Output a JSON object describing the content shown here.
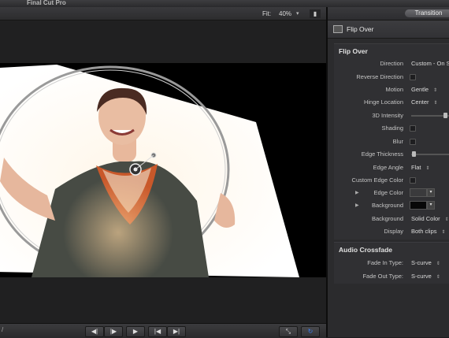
{
  "window": {
    "app_title": "Final Cut Pro"
  },
  "viewer": {
    "fit_label": "Fit:",
    "fit_value": "40%",
    "view_switch_glyph": "▮"
  },
  "transport": {
    "left_glyph": "/",
    "prev_glyph": "◀︎|",
    "next_glyph": "|▶︎",
    "play_glyph": "▶",
    "start_glyph": "|◀",
    "end_glyph": "▶|",
    "fullscreen_glyph": "⤡",
    "loop_glyph": "↻"
  },
  "inspector": {
    "tab_label": "Transition",
    "header_title": "Flip Over",
    "flip_over": {
      "title": "Flip Over",
      "direction_label": "Direction",
      "direction_value": "Custom - On Scr",
      "reverse_label": "Reverse Direction",
      "motion_label": "Motion",
      "motion_value": "Gentle",
      "hinge_label": "Hinge Location",
      "hinge_value": "Center",
      "intensity_label": "3D Intensity",
      "intensity_level": 0.75,
      "shading_label": "Shading",
      "blur_label": "Blur",
      "edge_thickness_label": "Edge Thickness",
      "edge_thickness_level": 0.02,
      "edge_angle_label": "Edge Angle",
      "edge_angle_value": "Flat",
      "custom_edge_color_label": "Custom Edge Color",
      "edge_color_label": "Edge Color",
      "edge_color_swatch": "#3a3a3c",
      "background_color_label": "Background",
      "background_color_swatch": "#080808",
      "background_type_label": "Background",
      "background_type_value": "Solid Color",
      "display_label": "Display",
      "display_value": "Both clips"
    },
    "audio_crossfade": {
      "title": "Audio Crossfade",
      "fade_in_label": "Fade In Type:",
      "fade_in_value": "S-curve",
      "fade_out_label": "Fade Out Type:",
      "fade_out_value": "S-curve"
    }
  },
  "colors": {
    "accent_blue": "#3a7cf0",
    "panel_bg": "#2b2b2d"
  }
}
